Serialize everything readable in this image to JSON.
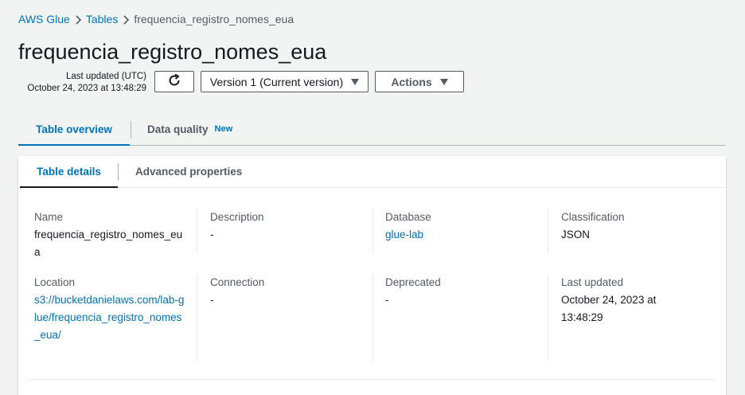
{
  "breadcrumb": {
    "items": [
      "AWS Glue",
      "Tables"
    ],
    "current": "frequencia_registro_nomes_eua"
  },
  "header": {
    "title": "frequencia_registro_nomes_eua",
    "last_updated_label": "Last updated (UTC)",
    "last_updated_value": "October 24, 2023 at 13:48:29",
    "version_label": "Version 1 (Current version)",
    "actions_label": "Actions",
    "refresh_icon": "refresh-icon"
  },
  "tabs": [
    {
      "label": "Table overview",
      "active": true
    },
    {
      "label": "Data quality",
      "badge": "New",
      "active": false
    }
  ],
  "subtabs": [
    {
      "label": "Table details",
      "active": true
    },
    {
      "label": "Advanced properties",
      "active": false
    }
  ],
  "details": {
    "name": {
      "label": "Name",
      "value": "frequencia_registro_nomes_eua"
    },
    "description": {
      "label": "Description",
      "value": "-"
    },
    "database": {
      "label": "Database",
      "value": "glue-lab"
    },
    "classification": {
      "label": "Classification",
      "value": "JSON"
    },
    "location": {
      "label": "Location",
      "value": "s3://bucketdanielaws.com/lab-glue/frequencia_registro_nomes_eua/"
    },
    "connection": {
      "label": "Connection",
      "value": "-"
    },
    "deprecated": {
      "label": "Deprecated",
      "value": "-"
    },
    "last_updated": {
      "label": "Last updated",
      "value": "October 24, 2023 at 13:48:29"
    }
  },
  "colors": {
    "link": "#0073bb",
    "text": "#16191f",
    "secondary": "#545b64",
    "background": "#f2f3f3"
  }
}
